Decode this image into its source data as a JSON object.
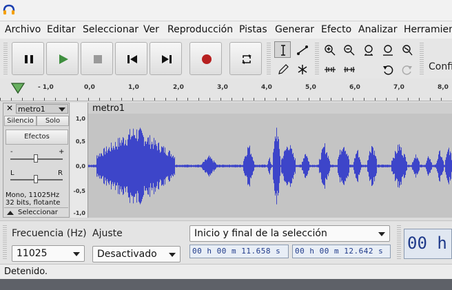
{
  "menu": [
    "Archivo",
    "Editar",
    "Seleccionar",
    "Ver",
    "Reproducción",
    "Pistas",
    "Generar",
    "Efecto",
    "Analizar",
    "Herramien"
  ],
  "transport": {
    "pause_icon": "pause-icon",
    "play_icon": "play-icon",
    "stop_icon": "stop-icon",
    "skip_start_icon": "skip-to-start-icon",
    "skip_end_icon": "skip-to-end-icon",
    "record_icon": "record-icon",
    "loop_icon": "loop-icon"
  },
  "toolbar": {
    "config_label": "Confi"
  },
  "ruler": {
    "ticks": [
      "- 1,0",
      "0,0",
      "1,0",
      "2,0",
      "3,0",
      "4,0",
      "5,0",
      "6,0",
      "7,0",
      "8,0"
    ]
  },
  "track": {
    "name": "metro1",
    "mute_label": "Silencio",
    "solo_label": "Solo",
    "effects_label": "Efectos",
    "gain_minus": "-",
    "gain_plus": "+",
    "pan_left": "L",
    "pan_right": "R",
    "info_line1": "Mono, 11025Hz",
    "info_line2": "32 bits, flotante",
    "select_label": "Seleccionar",
    "title": "metro1",
    "scale": [
      "1,0",
      "0,5",
      "0,0",
      "-0,5",
      "-1,0"
    ]
  },
  "selection": {
    "rate_label": "Frecuencia (Hz)",
    "rate_value": "11025",
    "snap_label": "Ajuste",
    "snap_value": "Desactivado",
    "mode_value": "Inicio y final de la selección",
    "start_time": "00 h 00 m 11.658 s",
    "end_time": "00 h 00 m 12.642 s",
    "big_time": "00 h"
  },
  "status": {
    "text": "Detenido."
  },
  "colors": {
    "waveform": "#3d45c9",
    "record": "#b72020",
    "play": "#3f8f3f",
    "wave_bg": "#c4c4c4"
  }
}
